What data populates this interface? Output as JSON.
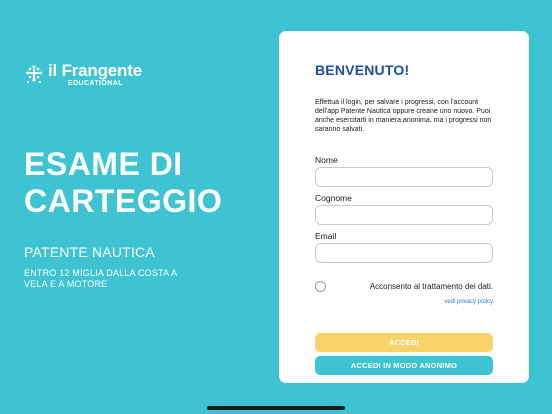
{
  "brand": {
    "name": "il Frangente",
    "sub": "EDUCATIONAL"
  },
  "hero": {
    "title": "ESAME DI CARTEGGIO",
    "subtitle": "PATENTE NAUTICA",
    "note": "ENTRO 12 MIGLIA DALLA COSTA A VELA E A MOTORE"
  },
  "login": {
    "title": "BENVENUTO!",
    "intro": "Effettua il login, per salvare i progressi, con l'account dell'app Patente Nautica oppure creane uno nuovo. Puoi anche esercitarti in maniera anonima, ma i progressi non saranno salvati.",
    "fields": {
      "nome": {
        "label": "Nome",
        "value": ""
      },
      "cognome": {
        "label": "Cognome",
        "value": ""
      },
      "email": {
        "label": "Email",
        "value": ""
      }
    },
    "consent": "Acconsento al trattamento dei dati.",
    "privacy_link": "vedi privacy policy",
    "login_button": "ACCEDI",
    "anon_button": "ACCEDI IN MODO ANONIMO"
  },
  "colors": {
    "background": "#3ec3d3",
    "title_blue": "#1f4fa5",
    "login_yellow": "#f8d36a",
    "link_blue": "#2a7bd6"
  },
  "icons": {
    "logo": "frangente-wave-logo-icon"
  }
}
